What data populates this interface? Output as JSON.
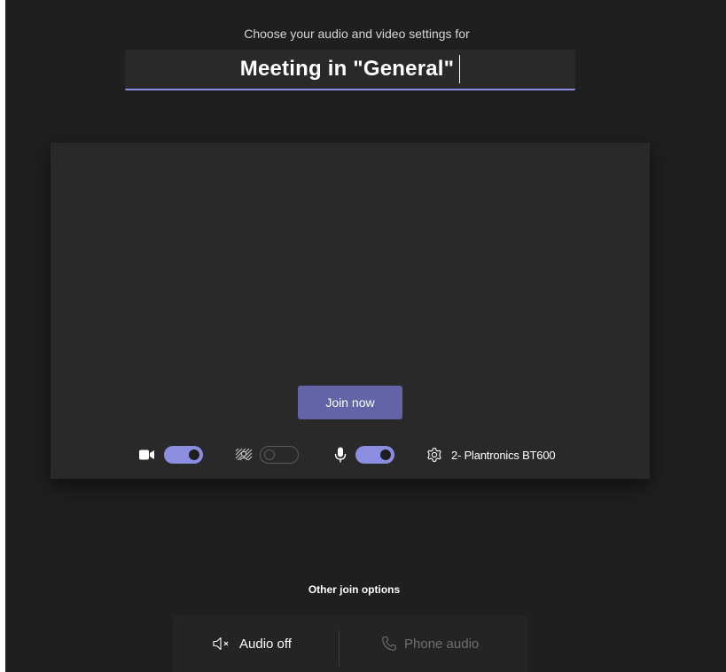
{
  "header": {
    "subtitle": "Choose your audio and video settings for",
    "meeting_title": "Meeting in \"General\""
  },
  "preview": {
    "join_label": "Join now",
    "camera": {
      "icon": "video-camera-icon",
      "enabled": true
    },
    "background_blur": {
      "icon": "background-blur-icon",
      "enabled": false
    },
    "microphone": {
      "icon": "microphone-icon",
      "enabled": true
    },
    "device": {
      "icon": "gear-icon",
      "label": "2- Plantronics BT600"
    }
  },
  "other_options": {
    "heading": "Other join options",
    "audio_off_label": "Audio off",
    "phone_audio_label": "Phone audio"
  },
  "colors": {
    "background": "#1f1f1f",
    "panel": "#292929",
    "accent": "#6264a7",
    "toggle_on": "#8b8ee0"
  }
}
